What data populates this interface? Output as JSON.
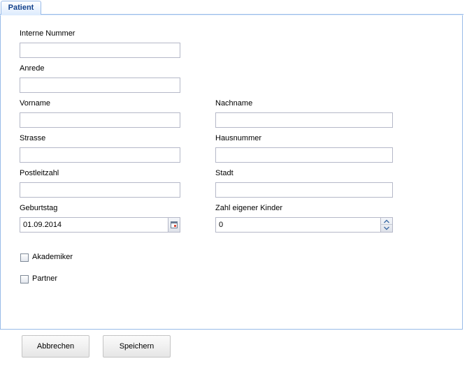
{
  "tab": {
    "label": "Patient"
  },
  "form": {
    "interne_nummer": {
      "label": "Interne Nummer",
      "value": ""
    },
    "anrede": {
      "label": "Anrede",
      "value": ""
    },
    "vorname": {
      "label": "Vorname",
      "value": ""
    },
    "nachname": {
      "label": "Nachname",
      "value": ""
    },
    "strasse": {
      "label": "Strasse",
      "value": ""
    },
    "hausnummer": {
      "label": "Hausnummer",
      "value": ""
    },
    "postleitzahl": {
      "label": "Postleitzahl",
      "value": ""
    },
    "stadt": {
      "label": "Stadt",
      "value": ""
    },
    "geburtstag": {
      "label": "Geburtstag",
      "value": "01.09.2014"
    },
    "kinder": {
      "label": "Zahl eigener Kinder",
      "value": "0"
    },
    "akademiker": {
      "label": "Akademiker",
      "checked": false
    },
    "partner": {
      "label": "Partner",
      "checked": false
    }
  },
  "buttons": {
    "cancel": "Abbrechen",
    "save": "Speichern"
  },
  "icons": {
    "date_trigger": "calendar-icon",
    "spin_up": "chevron-up-icon",
    "spin_down": "chevron-down-icon"
  },
  "colors": {
    "tab_border": "#99bbe8",
    "tab_text": "#15428b",
    "field_border": "#b5b8c8"
  }
}
